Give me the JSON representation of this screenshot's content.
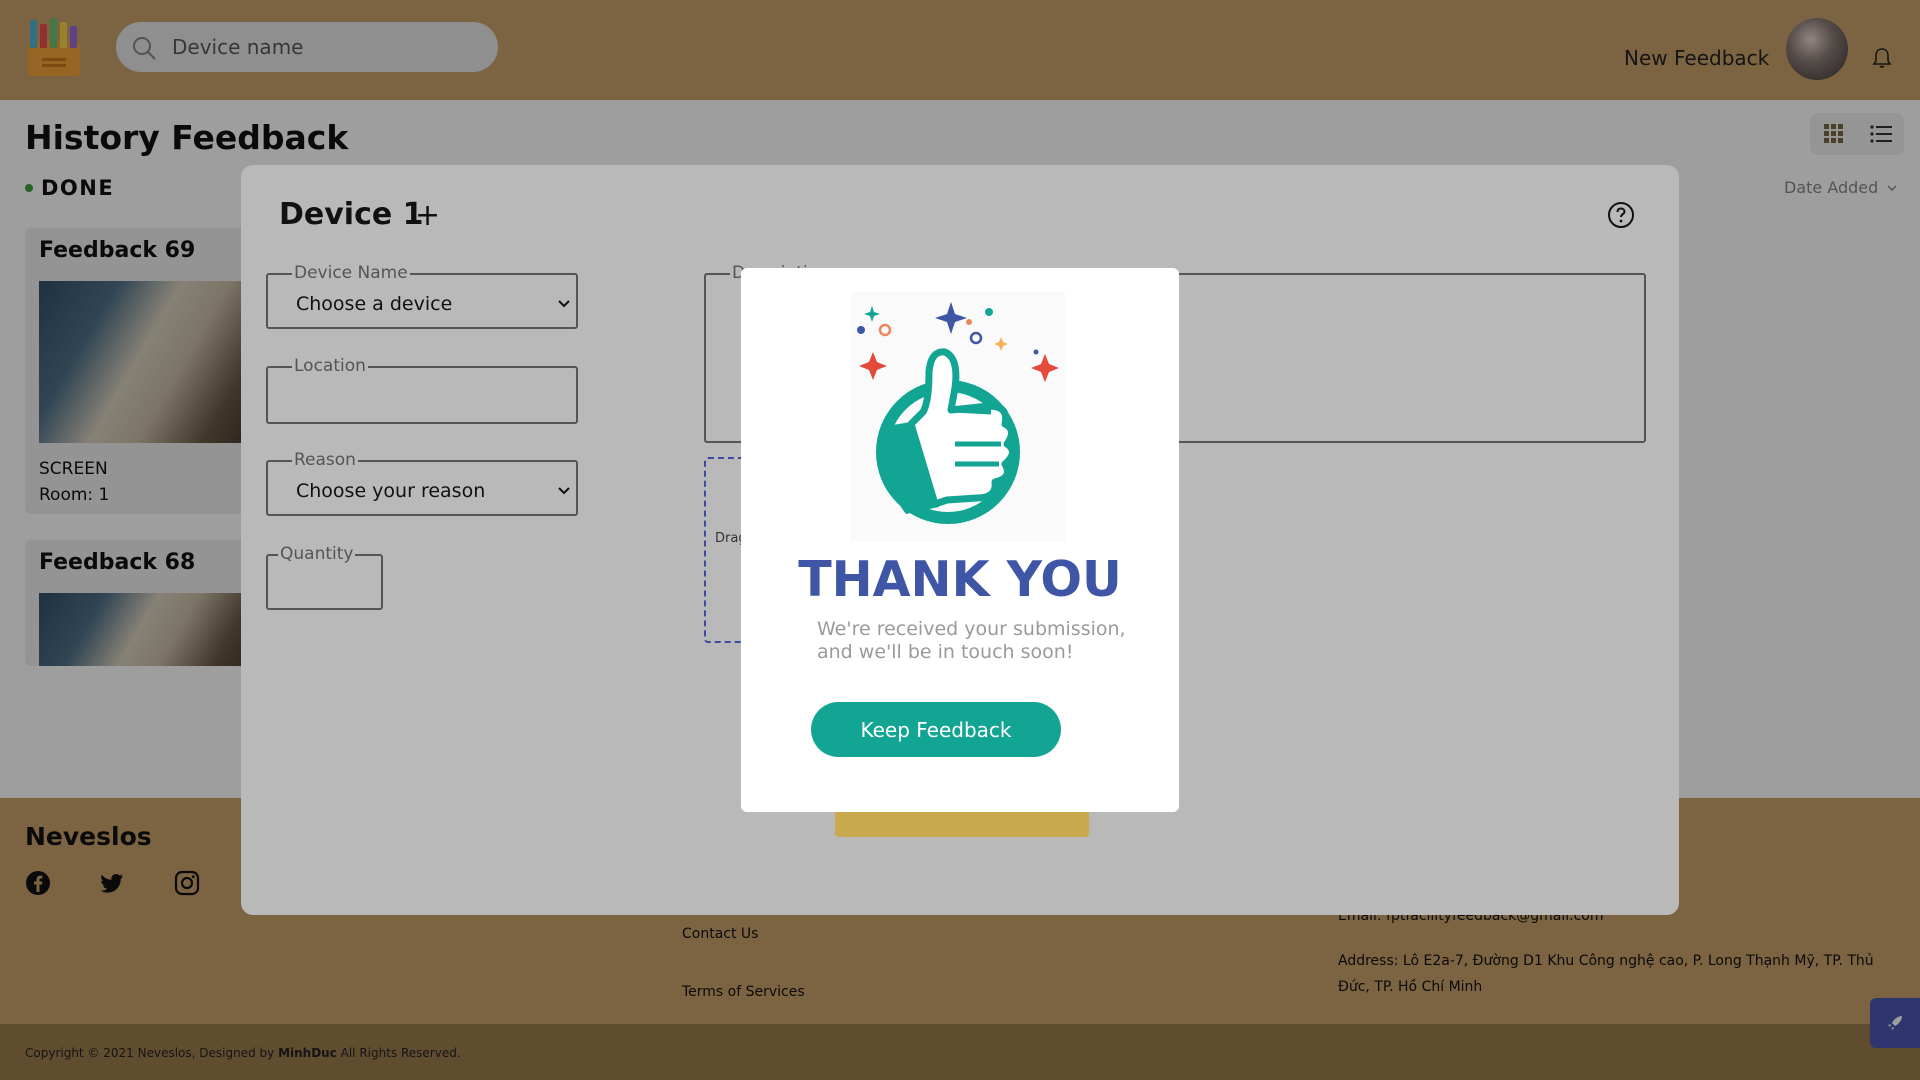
{
  "header": {
    "search_placeholder": "Device name",
    "new_feedback": "New Feedback"
  },
  "page": {
    "title": "History Feedback",
    "status": "DONE",
    "sort_label": "Date Added"
  },
  "cards": [
    {
      "title": "Feedback 69",
      "device": "SCREEN",
      "room": "Room: 1"
    },
    {
      "title": "Feedback 68"
    }
  ],
  "footer": {
    "brand": "Neveslos",
    "links": [
      "Contact Us",
      "Terms of Services"
    ],
    "email": "Email: fptfacilityfeedback@gmail.com",
    "address": "Address: Lô E2a-7, Đường D1 Khu Công nghệ cao, P. Long Thạnh Mỹ, TP. Thủ Đức, TP. Hồ Chí Minh",
    "copyright_prefix": "Copyright © 2021 Neveslos, Designed by ",
    "copyright_author": "MinhDuc",
    "copyright_suffix": " All Rights Reserved."
  },
  "form": {
    "title": "Device 1",
    "plus": "+",
    "device_name_label": "Device Name",
    "device_name_value": "Choose a device",
    "location_label": "Location",
    "location_value": "",
    "reason_label": "Reason",
    "reason_value": "Choose your reason",
    "quantity_label": "Quantity",
    "quantity_value": "",
    "description_label": "Description",
    "dropzone_text": "Drag"
  },
  "popup": {
    "title": "THANK YOU",
    "message": "We're received your submission, and we'll be in touch soon!",
    "button": "Keep Feedback"
  },
  "colors": {
    "header_bg": "#c9a26b",
    "popup_title": "#3f55a5",
    "popup_button": "#12a593",
    "dropzone_border": "#3c4aa0"
  },
  "icons": [
    "logo-icon",
    "search-icon",
    "bell-icon",
    "grid-view-icon",
    "list-view-icon",
    "chevron-down-icon",
    "plus-icon",
    "help-icon",
    "facebook-icon",
    "twitter-icon",
    "instagram-icon",
    "rocket-icon",
    "thumbs-up-illustration"
  ]
}
